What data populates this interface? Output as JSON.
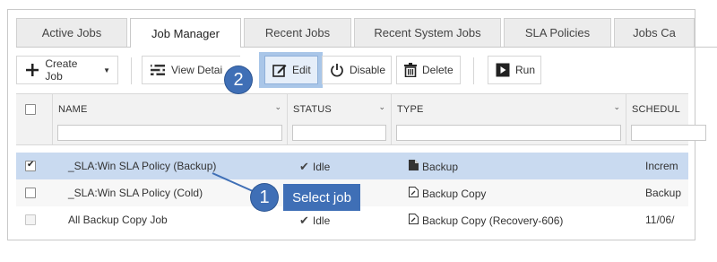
{
  "tabs": [
    {
      "label": "Active Jobs",
      "active": false
    },
    {
      "label": "Job Manager",
      "active": true
    },
    {
      "label": "Recent Jobs",
      "active": false
    },
    {
      "label": "Recent System Jobs",
      "active": false
    },
    {
      "label": "SLA Policies",
      "active": false
    },
    {
      "label": "Jobs Ca",
      "active": false
    }
  ],
  "toolbar": {
    "create_label": "Create Job",
    "view_details_label": "View Detai",
    "edit_label": "Edit",
    "disable_label": "Disable",
    "delete_label": "Delete",
    "run_label": "Run"
  },
  "columns": [
    "NAME",
    "STATUS",
    "TYPE",
    "SCHEDUL"
  ],
  "rows": [
    {
      "name": "_SLA:Win SLA Policy (Backup)",
      "status": "Idle",
      "type": "Backup",
      "schedule": "Increm",
      "checked": true,
      "selected": true
    },
    {
      "name": "_SLA:Win SLA Policy (Cold)",
      "status": "",
      "type": "Backup Copy",
      "schedule": "Backup",
      "checked": false,
      "selected": false
    },
    {
      "name": "All Backup Copy Job",
      "status": "Idle",
      "type": "Backup Copy (Recovery-606)",
      "schedule": "11/06/",
      "checked": false,
      "selected": false
    }
  ],
  "callouts": {
    "one_number": "1",
    "one_text": "Select job",
    "two_number": "2"
  },
  "colors": {
    "callout": "#3f6fb6",
    "selection": "#c9daf0",
    "edit_highlight": "#a9c6e8"
  }
}
